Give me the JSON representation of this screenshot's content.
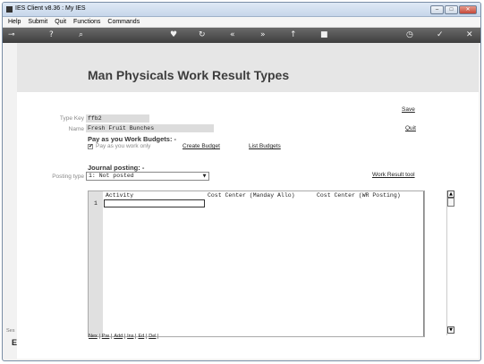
{
  "window": {
    "title": "IES Client v8.36 : My IES",
    "controls": {
      "minimize": "–",
      "maximize": "□",
      "close": "✕"
    }
  },
  "menu": [
    "Help",
    "Submit",
    "Quit",
    "Functions",
    "Commands"
  ],
  "toolbar": {
    "icons": [
      "key-icon",
      "help-icon",
      "search-icon",
      "heart-icon",
      "refresh-icon",
      "first-icon",
      "last-icon",
      "upload-icon",
      "stop-icon",
      "history-icon",
      "check-icon",
      "close-icon"
    ]
  },
  "page": {
    "title": "Man Physicals Work Result Types"
  },
  "form": {
    "type_key_label": "Type Key",
    "type_key_value": "ffb2",
    "name_label": "Name",
    "name_value": "Fresh Fruit Bunches",
    "save_label": "Save",
    "quit_label": "Quit",
    "pay_section": "Pay as you Work Budgets: -",
    "pay_check_label": "Pay as you work only",
    "pay_check_mark": "✔",
    "create_budget": "Create Budget",
    "list_budgets": "List Budgets",
    "journal_section": "Journal posting: -",
    "posting_type_label": "Posting type",
    "posting_type_value": "1: Not posted",
    "work_result_tool": "Work Result tool"
  },
  "grid": {
    "columns": [
      "Activity",
      "Cost Center (Manday Allo)",
      "Cost Center (WR Posting)"
    ],
    "rows": [
      {
        "num": "1",
        "activity": ""
      }
    ],
    "row_buttons": [
      "Nex",
      "Pre",
      "Add",
      "Ins",
      "Ed",
      "Del"
    ]
  },
  "side_fragments": {
    "a": "Ses",
    "b": "E"
  }
}
